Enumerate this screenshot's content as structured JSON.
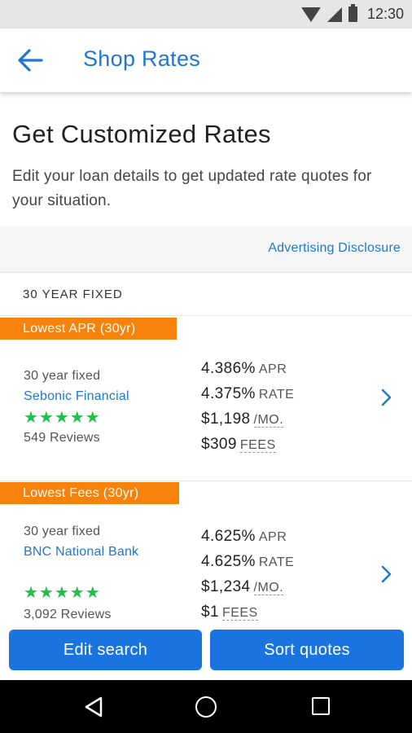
{
  "status_bar": {
    "time": "12:30"
  },
  "app_bar": {
    "title": "Shop Rates"
  },
  "header": {
    "title": "Get Customized Rates",
    "subtitle": "Edit your loan details to get updated rate quotes for your situation."
  },
  "disclosure": {
    "label": "Advertising Disclosure"
  },
  "section": {
    "label": "30 YEAR FIXED"
  },
  "quotes": [
    {
      "badge": "Lowest APR (30yr)",
      "term": "30 year fixed",
      "lender": "Sebonic Financial",
      "stars": "★★★★★",
      "reviews": "549 Reviews",
      "apr": "4.386%",
      "apr_label": "APR",
      "rate": "4.375%",
      "rate_label": "RATE",
      "monthly": "$1,198",
      "monthly_label": "/MO.",
      "fees": "$309",
      "fees_label": "FEES"
    },
    {
      "badge": "Lowest Fees (30yr)",
      "term": "30 year fixed",
      "lender": "BNC National Bank",
      "stars": "★★★★★",
      "reviews": "3,092 Reviews",
      "apr": "4.625%",
      "apr_label": "APR",
      "rate": "4.625%",
      "rate_label": "RATE",
      "monthly": "$1,234",
      "monthly_label": "/MO.",
      "fees": "$1",
      "fees_label": "FEES"
    }
  ],
  "buttons": {
    "edit": "Edit search",
    "sort": "Sort quotes"
  },
  "colors": {
    "accent": "#1f77d0",
    "badge": "#f7820b",
    "stars": "#1fbf4a",
    "button": "#1a74e0"
  },
  "icons": [
    "wifi-icon",
    "signal-icon",
    "battery-icon",
    "back-arrow-icon",
    "chevron-right-icon",
    "nav-back-icon",
    "nav-home-icon",
    "nav-recents-icon"
  ]
}
